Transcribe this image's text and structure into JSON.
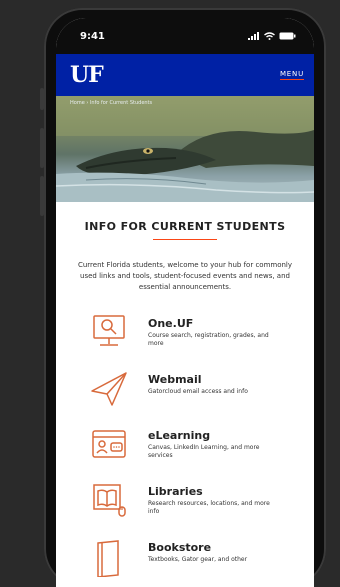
{
  "status": {
    "time": "9:41"
  },
  "header": {
    "logo": "UF",
    "menu_label": "MENU"
  },
  "breadcrumb": {
    "home": "Home",
    "separator": "›",
    "current": "Info for Current Students"
  },
  "page": {
    "title": "INFO FOR CURRENT STUDENTS",
    "intro": "Current Florida students, welcome to your hub for commonly used links and tools, student-focused events and news, and essential announcements."
  },
  "links": [
    {
      "title": "One.UF",
      "desc": "Course search, registration, grades, and more",
      "icon": "computer-search-icon"
    },
    {
      "title": "Webmail",
      "desc": "Gatorcloud email access and info",
      "icon": "paper-plane-icon"
    },
    {
      "title": "eLearning",
      "desc": "Canvas, LinkedIn Learning, and more services",
      "icon": "id-card-icon"
    },
    {
      "title": "Libraries",
      "desc": "Research resources, locations, and more info",
      "icon": "open-book-icon"
    },
    {
      "title": "Bookstore",
      "desc": "Textbooks, Gator gear, and other",
      "icon": "book-icon"
    }
  ],
  "colors": {
    "brand_blue": "#0021a5",
    "accent_orange": "#fa4616"
  }
}
